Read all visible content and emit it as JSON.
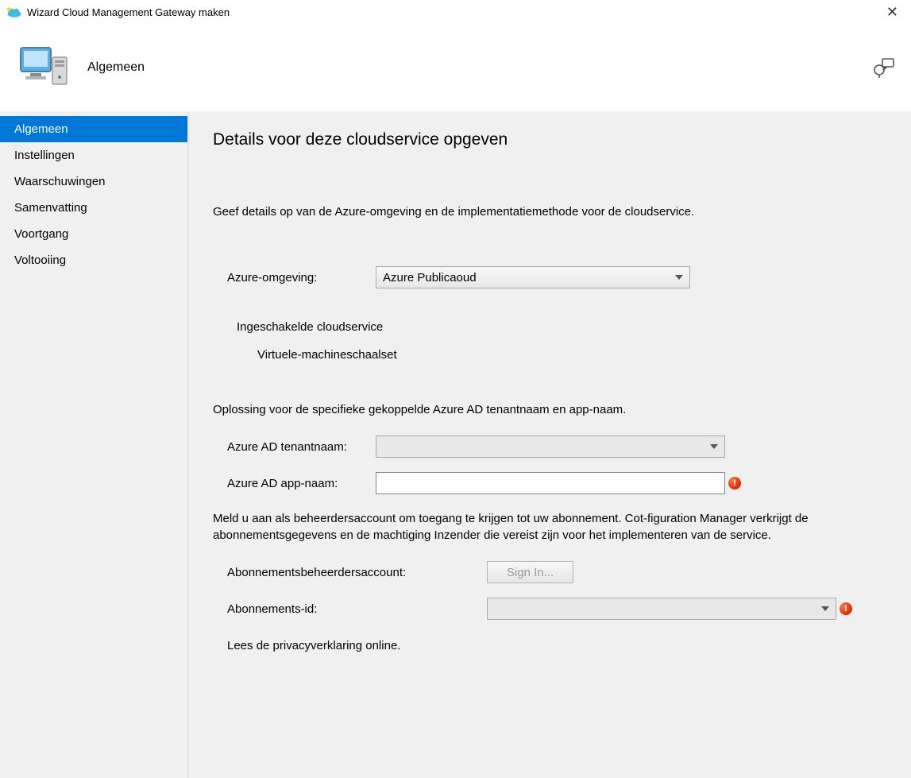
{
  "titlebar": {
    "title": "Wizard Cloud Management Gateway maken"
  },
  "header": {
    "title": "Algemeen"
  },
  "sidebar": {
    "items": [
      {
        "label": "Algemeen",
        "selected": true
      },
      {
        "label": "Instellingen",
        "selected": false
      },
      {
        "label": "Waarschuwingen",
        "selected": false
      },
      {
        "label": "Samenvatting",
        "selected": false
      },
      {
        "label": "Voortgang",
        "selected": false
      },
      {
        "label": "Voltooiing",
        "selected": false
      }
    ]
  },
  "content": {
    "pageTitle": "Details voor deze cloudservice opgeven",
    "desc1": "Geef details op van de Azure-omgeving en de implementatiemethode voor de cloudservice.",
    "azureEnvLabel": "Azure-omgeving:",
    "azureEnvValue": "Azure Publicaoud",
    "enabledCloudServiceLabel": "Ingeschakelde cloudservice",
    "vmssLabel": "Virtuele-machineschaalset",
    "desc2": "Oplossing voor de specifieke gekoppelde Azure AD tenantnaam en app-naam.",
    "tenantLabel": "Azure AD tenantnaam:",
    "tenantValue": "",
    "appNameLabel": "Azure AD app-naam:",
    "appNameValue": "",
    "desc3": "Meld u aan als beheerdersaccount om toegang te krijgen tot uw abonnement. Cot-figuration Manager verkrijgt de abonnementsgegevens en de machtiging Inzender die vereist zijn voor het implementeren van de service.",
    "adminAccountLabel": "Abonnementsbeheerdersaccount:",
    "signInButton": "Sign In...",
    "subscriptionIdLabel": "Abonnements-id:",
    "subscriptionIdValue": "",
    "privacyLink": "Lees de privacyverklaring online.",
    "errorGlyph": "!"
  }
}
